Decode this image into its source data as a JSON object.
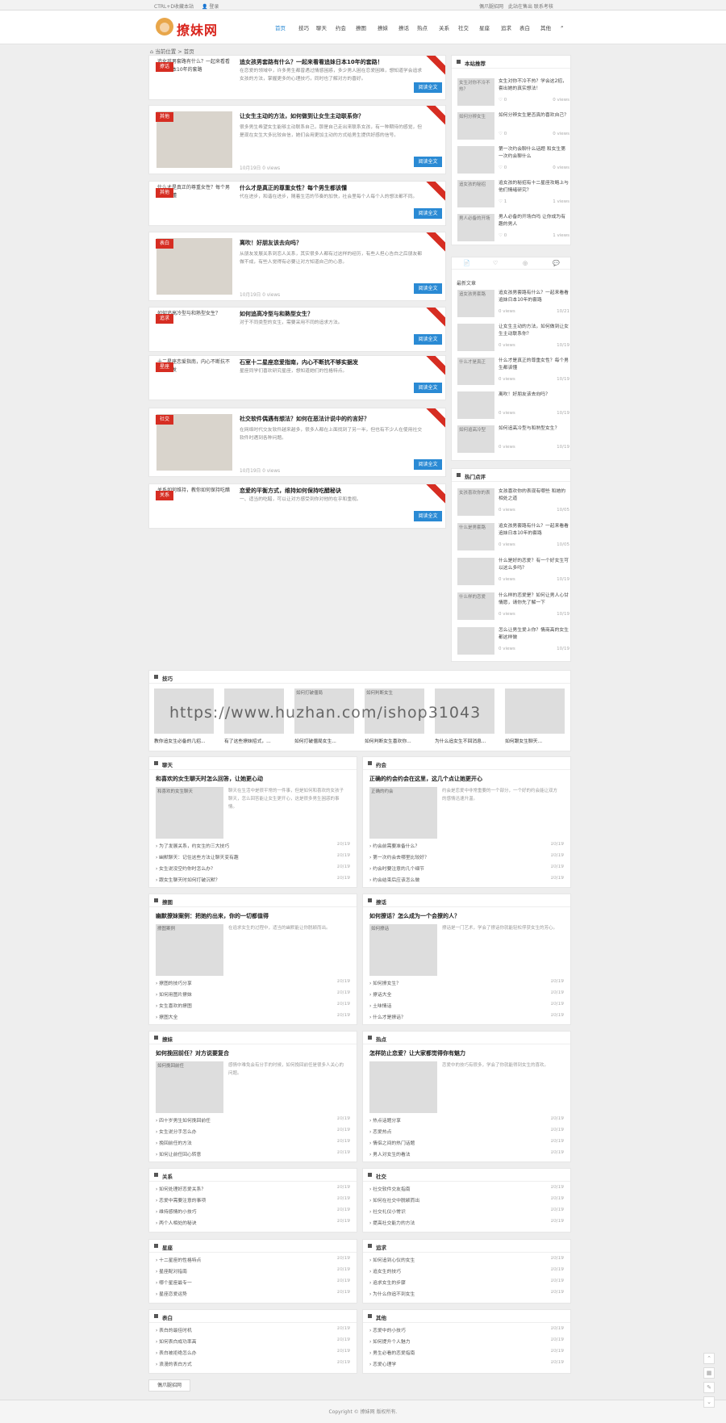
{
  "topbar": {
    "left1": "CTRL+D收藏本站",
    "left2": "登录",
    "right1": "偶爪腿招网",
    "right2": "此站在售出 联系考核"
  },
  "logo": {
    "text": "撩妹网"
  },
  "nav": [
    "首页",
    "技巧",
    "聊天",
    "约会",
    "撩图",
    "撩妹",
    "撩话",
    "热点",
    "关系",
    "社交",
    "星座",
    "追求",
    "表白",
    "其他"
  ],
  "crumb": "当前位置 > 首页",
  "posts": [
    {
      "cat": "撩话",
      "title": "追女孩男套路有什么？一起来看看追妹日本10年的套路！",
      "thumb": "追女孩男套路有什么？一起来看看追妹日本10年的套路",
      "ex": "在恋爱的领域中，许多男生都曾遇过情感困惑，多少男人困在恋爱困难，想知道学会追求女孩的方法，掌握更多的心理技巧，同时也了解对方的喜好。",
      "meta": "",
      "more": "阅读全文"
    },
    {
      "cat": "其他",
      "title": "让女生主动的方法，如何做到让女生主动联系你？",
      "thumb": "",
      "ex": "很多男生希望女生能够主动联系自己，那是自己走出来联系女孩，有一种期待的感觉，但是现在女生大多比较自信，她们会用更加主动的方式给男生提供好感的信号。",
      "meta": "10月19日 0 views",
      "more": "阅读全文"
    },
    {
      "cat": "其他",
      "title": "什么才是真正的尊重女性？每个男生都该懂",
      "thumb": "什么才是真正的尊重女性？每个男生都该懂",
      "ex": "代在进步，和谐在进步，随着生活的节奏的加快，社会里每个人每个人的想法都不同。",
      "meta": "",
      "more": "阅读全文"
    },
    {
      "cat": "表白",
      "title": "离吹！好朋友该去向吗？",
      "thumb": "",
      "ex": "从朋友发展关系到恋人关系，其实很多人都有过这样的经历，有些人担心告白之后朋友都做不成，有些人觉得有必要让对方知道自己的心意。",
      "meta": "10月19日 0 views",
      "more": "阅读全文"
    },
    {
      "cat": "追求",
      "title": "如何追高冷型与和熟型女生？",
      "thumb": "如何追高冷型与和熟型女生？",
      "ex": "对于不同类型的女生，需要采用不同的追求方法。",
      "meta": "",
      "more": "阅读全文"
    },
    {
      "cat": "星座",
      "title": "石室十二星座恋爱指南，内心不断抗不够实据发",
      "thumb": "十二星座恋爱指南，内心不断抗不够实据发",
      "ex": "星座同学们喜欢研究星座，想知道她们的性格特点。",
      "meta": "",
      "more": "阅读全文"
    },
    {
      "cat": "社交",
      "title": "社交软件偶遇有想法？如何在恶法计说中的约言好？",
      "thumb": "",
      "ex": "在网络时代交友软件越来越多，很多人都在上面找到了另一半，但也有不少人在使用社交软件时遇到各种问题。",
      "meta": "10月19日 0 views",
      "more": "阅读全文"
    },
    {
      "cat": "关系",
      "title": "恋爱的平衡方式，维持如何保持吃醋秘诀",
      "thumb": "关系如何维持，教你如何保持吃醋秘诀",
      "ex": "一、适当的吃醋，可以让对方感受到你对他的在乎和重视。",
      "meta": "",
      "more": "阅读全文"
    }
  ],
  "sidebar": {
    "recommend_title": "本站推荐",
    "recommend": [
      {
        "img": "女生对你不冷不热？",
        "t": "女生对你不冷不热？学会这2招，套出她的真实想法！",
        "v": "0",
        "views": "0 views"
      },
      {
        "img": "如何分辨女生",
        "t": "如何分辨女生是否真的喜欢自己？",
        "v": "0",
        "views": "0 views"
      },
      {
        "img": "",
        "t": "第一次约会聊什么话题 和女生第一次约会聊什么",
        "v": "0",
        "views": "0 views"
      },
      {
        "img": "追女孩的秘招",
        "t": "追女孩的秘招有十二星座攻略上与他们情绪研究？",
        "v": "1",
        "views": "1 views"
      },
      {
        "img": "男人必备的开场",
        "t": "男人必备的开场白吗 让你成为有趣的男人",
        "v": "0",
        "views": "1 views"
      }
    ],
    "tabs": [
      "📄",
      "♡",
      "◎",
      "💬"
    ],
    "latest_title": "最新文章",
    "latest": [
      {
        "img": "追女孩男套路",
        "t": "追女孩男套路有什么？一起来看看追妹日本10年的套路",
        "v": "0 views",
        "d": "10/21"
      },
      {
        "img": "",
        "t": "让女生主动的方法，如何做到让女生主动联系你？",
        "v": "0 views",
        "d": "10/19"
      },
      {
        "img": "什么才是真正",
        "t": "什么才是真正的尊重女性？每个男生都该懂",
        "v": "0 views",
        "d": "10/19"
      },
      {
        "img": "",
        "t": "离吹！好朋友该去向吗？",
        "v": "0 views",
        "d": "10/19"
      },
      {
        "img": "如何追高冷型",
        "t": "如何追高冷型与和熟型女生？",
        "v": "0 views",
        "d": "10/19"
      }
    ],
    "hot_title": "热门点评",
    "hot": [
      {
        "img": "女孩喜欢你的表",
        "t": "女孩喜欢你的表现有哪些 和她的相处之道",
        "v": "0 views",
        "d": "10/05"
      },
      {
        "img": "什么是男套路",
        "t": "追女孩男套路有什么？一起来看看追妹日本10年的套路",
        "v": "0 views",
        "d": "10/05"
      },
      {
        "img": "",
        "t": "什么是好的恋爱？有一个好女生可以这么多吗？",
        "v": "0 views",
        "d": "10/19"
      },
      {
        "img": "什么样的恋爱",
        "t": "什么样的恋爱是？如何让男人心甘情愿，请你先了解一下",
        "v": "0 views",
        "d": "10/19"
      },
      {
        "img": "",
        "t": "怎么让男生爱上你？情商高的女生都这样做",
        "v": "0 views",
        "d": "10/19"
      }
    ]
  },
  "tips": {
    "title": "技巧",
    "items": [
      {
        "img": "",
        "t": "教你追女生必备的几招..."
      },
      {
        "img": "",
        "t": "有了这些撩妹招式，..."
      },
      {
        "img": "如何打破僵局",
        "t": "如何打破僵局女生..."
      },
      {
        "img": "如何判断女生",
        "t": "如何判断女生喜欢你..."
      },
      {
        "img": "",
        "t": "为什么追女生不回消息..."
      },
      {
        "img": "",
        "t": "如何跟女生聊天..."
      }
    ]
  },
  "watermark": "https://www.huzhan.com/ishop31043",
  "blocks": [
    {
      "name": "聊天",
      "title": "和喜欢的女生聊天时怎么回答，让她更心动",
      "img": "和喜欢的女生聊天",
      "ex": "聊天在生活中是很平常的一件事，但是如何和喜欢的女孩子聊天，怎么回答能让女生更开心，这是很多男生困惑的事情。",
      "list": [
        {
          "t": "为了发展关系，约女生的三大技巧",
          "d": "10/19"
        },
        {
          "t": "幽默聊天：记住这些方法让聊天变有趣",
          "d": "10/19"
        },
        {
          "t": "女生说没空约你时怎么办？",
          "d": "10/19"
        },
        {
          "t": "跟女生聊天时如何打破沉默？",
          "d": "10/19"
        }
      ]
    },
    {
      "name": "约会",
      "title": "正确的约会约会在这里，这几个点让她更开心",
      "img": "正确的约会",
      "ex": "约会是恋爱中非常重要的一个部分，一个好的约会能让双方的感情迅速升温。",
      "list": [
        {
          "t": "约会前需要准备什么？",
          "d": "10/19"
        },
        {
          "t": "第一次约会去哪里比较好？",
          "d": "10/19"
        },
        {
          "t": "约会时要注意的几个细节",
          "d": "10/19"
        },
        {
          "t": "约会结束后应该怎么做",
          "d": "10/19"
        }
      ]
    },
    {
      "name": "撩图",
      "title": "幽默撩妹案例：把她约出来，你的一切都值得",
      "img": "撩图案例",
      "ex": "在追求女生的过程中，适当的幽默能让你脱颖而出。",
      "list": [
        {
          "t": "撩图的技巧分享",
          "d": "10/19"
        },
        {
          "t": "如何用图片撩妹",
          "d": "10/19"
        },
        {
          "t": "女生喜欢的撩图",
          "d": "10/19"
        },
        {
          "t": "撩图大全",
          "d": "10/19"
        }
      ]
    },
    {
      "name": "撩话",
      "title": "如何撩话？怎么成为一个会撩的人？",
      "img": "如何撩话",
      "ex": "撩话是一门艺术，学会了撩话你就能轻松俘获女生的芳心。",
      "list": [
        {
          "t": "如何撩女生？",
          "d": "10/19"
        },
        {
          "t": "撩话大全",
          "d": "10/19"
        },
        {
          "t": "土味情话",
          "d": "10/19"
        },
        {
          "t": "什么才是撩话？",
          "d": "10/19"
        }
      ]
    },
    {
      "name": "撩妹",
      "title": "如何挽回前任？对方说要复合",
      "img": "如何挽回前任",
      "ex": "感情中难免会有分手的时候，如何挽回前任是很多人关心的问题。",
      "list": [
        {
          "t": "四十岁男生如何挽回前任",
          "d": "10/19"
        },
        {
          "t": "女生说分手怎么办",
          "d": "10/19"
        },
        {
          "t": "挽回前任的方法",
          "d": "10/19"
        },
        {
          "t": "如何让前任回心转意",
          "d": "10/19"
        }
      ]
    },
    {
      "name": "热点",
      "title": "怎样防止恋爱？让大家都觉得你有魅力",
      "img": "",
      "ex": "恋爱中的技巧有很多，学会了你就能得到女生的喜欢。",
      "list": [
        {
          "t": "热点话题分享",
          "d": "10/19"
        },
        {
          "t": "恋爱热点",
          "d": "10/19"
        },
        {
          "t": "情侣之间的热门话题",
          "d": "10/19"
        },
        {
          "t": "男人对女生的看法",
          "d": "10/19"
        }
      ]
    }
  ],
  "small_blocks": [
    {
      "name": "关系",
      "list": [
        {
          "t": "如何处理好恋爱关系？",
          "d": "10/19"
        },
        {
          "t": "恋爱中需要注意的事项",
          "d": "10/19"
        },
        {
          "t": "维持感情的小技巧",
          "d": "10/19"
        },
        {
          "t": "两个人相处的秘诀",
          "d": "10/19"
        }
      ]
    },
    {
      "name": "社交",
      "list": [
        {
          "t": "社交软件交友指南",
          "d": "10/19"
        },
        {
          "t": "如何在社交中脱颖而出",
          "d": "10/19"
        },
        {
          "t": "社交礼仪小常识",
          "d": "10/19"
        },
        {
          "t": "提高社交能力的方法",
          "d": "10/19"
        }
      ]
    },
    {
      "name": "星座",
      "list": [
        {
          "t": "十二星座的性格特点",
          "d": "10/19"
        },
        {
          "t": "星座配对指南",
          "d": "10/19"
        },
        {
          "t": "哪个星座最专一",
          "d": "10/19"
        },
        {
          "t": "星座恋爱运势",
          "d": "10/19"
        }
      ]
    },
    {
      "name": "追求",
      "list": [
        {
          "t": "如何追到心仪的女生",
          "d": "10/19"
        },
        {
          "t": "追女生的技巧",
          "d": "10/19"
        },
        {
          "t": "追求女生的步骤",
          "d": "10/19"
        },
        {
          "t": "为什么你追不到女生",
          "d": "10/19"
        }
      ]
    },
    {
      "name": "表白",
      "list": [
        {
          "t": "表白的最佳时机",
          "d": "10/19"
        },
        {
          "t": "如何表白成功率高",
          "d": "10/19"
        },
        {
          "t": "表白被拒绝怎么办",
          "d": "10/19"
        },
        {
          "t": "浪漫的表白方式",
          "d": "10/19"
        }
      ]
    },
    {
      "name": "其他",
      "list": [
        {
          "t": "恋爱中的小技巧",
          "d": "10/19"
        },
        {
          "t": "如何提升个人魅力",
          "d": "10/19"
        },
        {
          "t": "男生必看的恋爱指南",
          "d": "10/19"
        },
        {
          "t": "恋爱心理学",
          "d": "10/19"
        }
      ]
    }
  ],
  "friend_link": "偶爪腿招网",
  "footer": "Copyright © 撩妹网 版权所有."
}
